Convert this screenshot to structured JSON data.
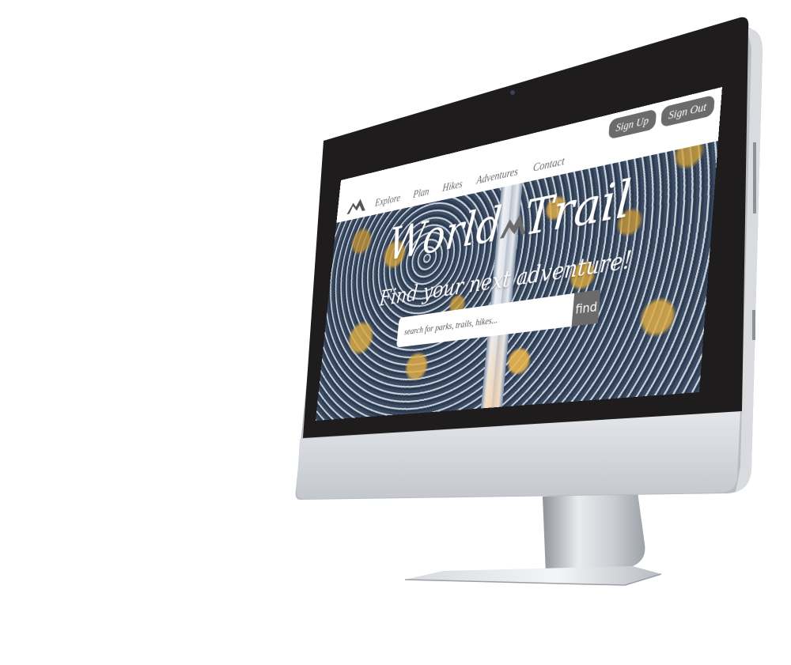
{
  "window": {
    "title": "World Trail"
  },
  "nav": {
    "items": [
      "Explore",
      "Plan",
      "Hikes",
      "Adventures",
      "Contact"
    ]
  },
  "auth": {
    "sign_up": "Sign Up",
    "sign_out": "Sign Out"
  },
  "hero": {
    "title_part1": "World",
    "title_part2": "Trail",
    "subtitle": "Find your next adventure!"
  },
  "search": {
    "placeholder": "search for parks, trails, hikes...",
    "button": "find"
  },
  "icons": {
    "logo": "mountain-logo-icon",
    "camera": "camera-icon"
  },
  "colors": {
    "nav_text": "#6a6a6a",
    "pill_bg": "#6b6b6b",
    "bezel": "#1f1c1d",
    "chin": "#d4d7dc"
  }
}
